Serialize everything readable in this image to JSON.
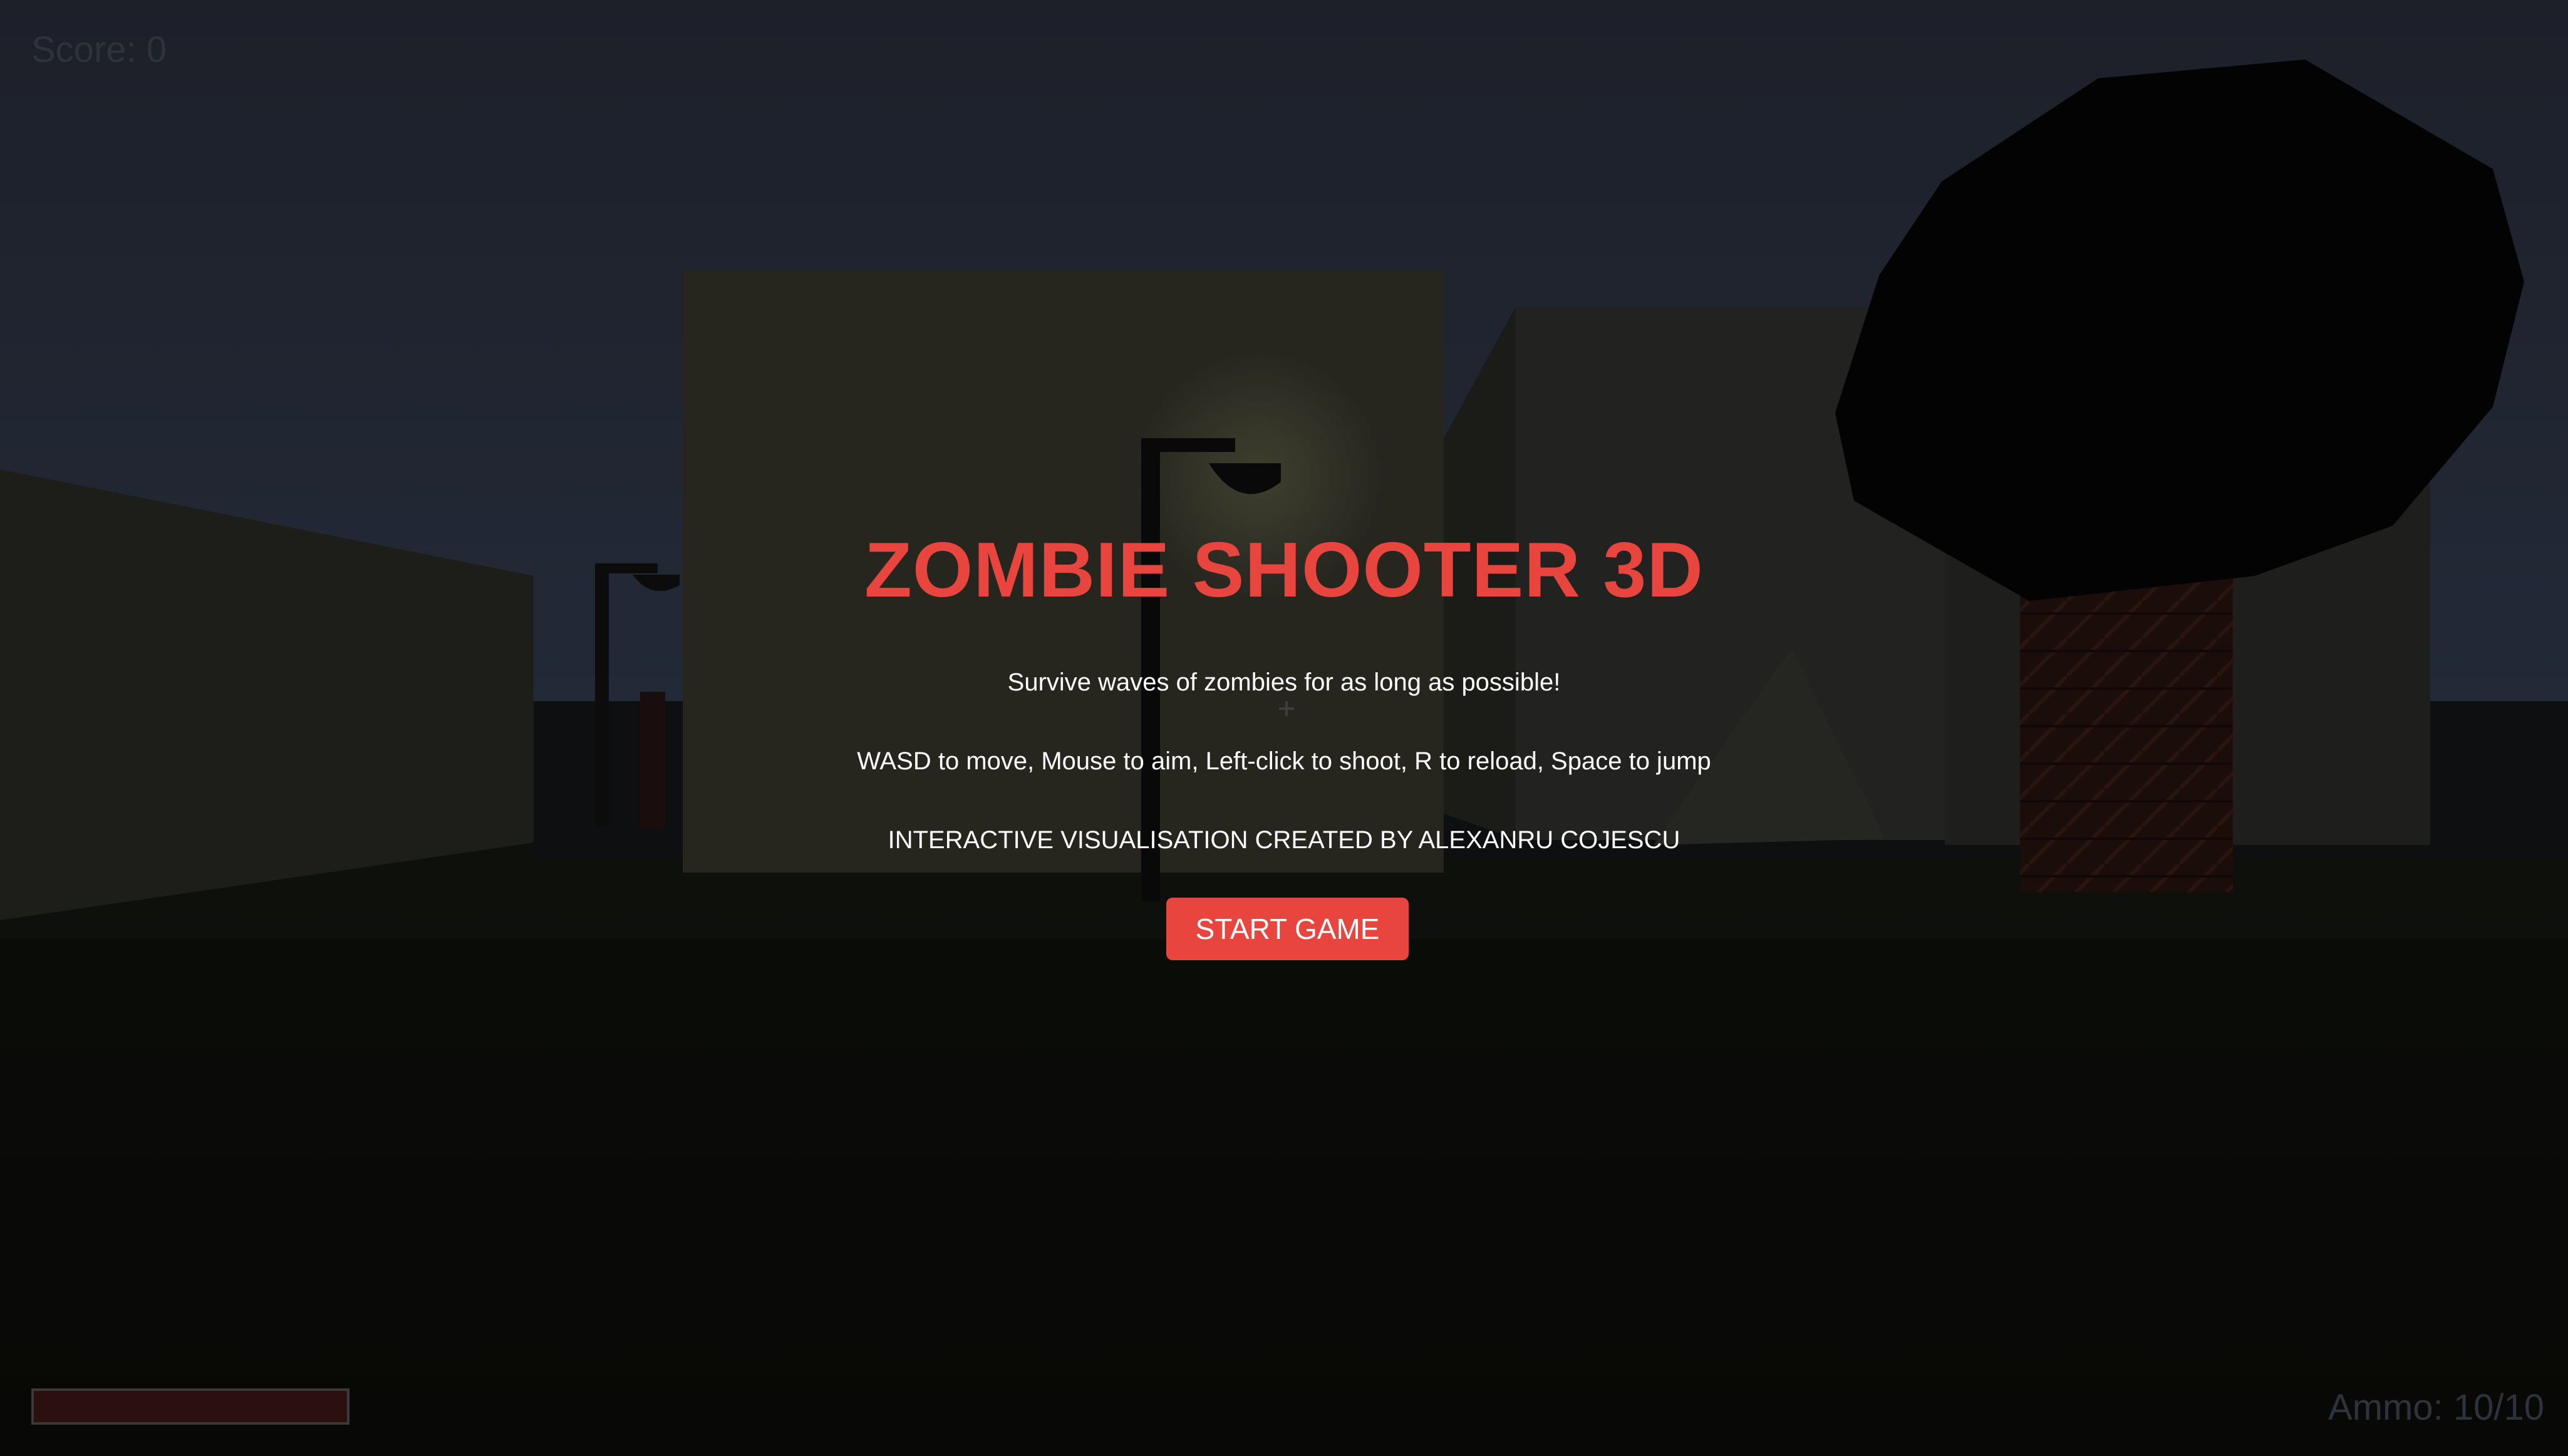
{
  "hud": {
    "score_label": "Score: 0",
    "ammo_label": "Ammo: 10/10",
    "health_fraction": 1.0
  },
  "menu": {
    "title": "ZOMBIE SHOOTER 3D",
    "subtitle": "Survive waves of zombies for as long as possible!",
    "controls": "WASD to move, Mouse to aim, Left-click to shoot, R to reload, Space to jump",
    "credit": "INTERACTIVE VISUALISATION CREATED BY ALEXANRU COJESCU",
    "start_button": "START GAME"
  },
  "colors": {
    "sky": "#1d2029",
    "ground": "#0b0d09",
    "accent": "#e7453e",
    "hud_text": "#2e323b"
  }
}
